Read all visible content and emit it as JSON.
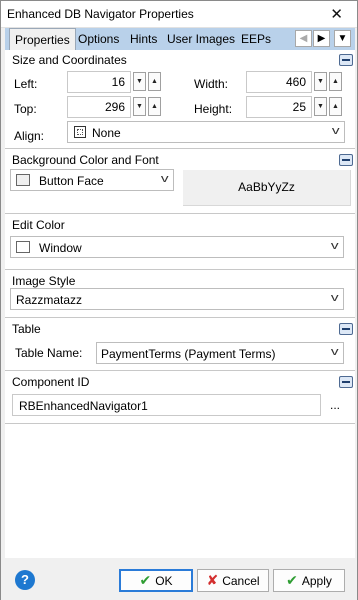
{
  "window": {
    "title": "Enhanced DB Navigator Properties",
    "close_glyph": "✕"
  },
  "tabs": [
    "Properties",
    "Options",
    "Hints",
    "User Images",
    "EEPs"
  ],
  "tab_nav": {
    "prev": "◀",
    "next": "▶",
    "menu": "▼"
  },
  "size_coords": {
    "title": "Size and Coordinates",
    "left_label": "Left:",
    "left_value": "16",
    "width_label": "Width:",
    "width_value": "460",
    "top_label": "Top:",
    "top_value": "296",
    "height_label": "Height:",
    "height_value": "25",
    "align_label": "Align:",
    "align_value": "None"
  },
  "background": {
    "title": "Background Color and Font",
    "color_value": "Button Face",
    "font_preview": "AaBbYyZz"
  },
  "edit_color": {
    "title": "Edit Color",
    "value": "Window"
  },
  "image_style": {
    "title": "Image Style",
    "value": "Razzmatazz"
  },
  "table": {
    "title": "Table",
    "label": "Table Name:",
    "value": "PaymentTerms  (Payment Terms)"
  },
  "component": {
    "title": "Component ID",
    "value": "RBEnhancedNavigator1",
    "ellipsis": "..."
  },
  "buttons": {
    "help": "?",
    "ok": "OK",
    "cancel": "Cancel",
    "apply": "Apply"
  },
  "colors": {
    "tabstrip": "#b9d1ea",
    "help": "#1e78d0",
    "ok_check": "#2e9d32",
    "cancel_x": "#d32f2f"
  }
}
